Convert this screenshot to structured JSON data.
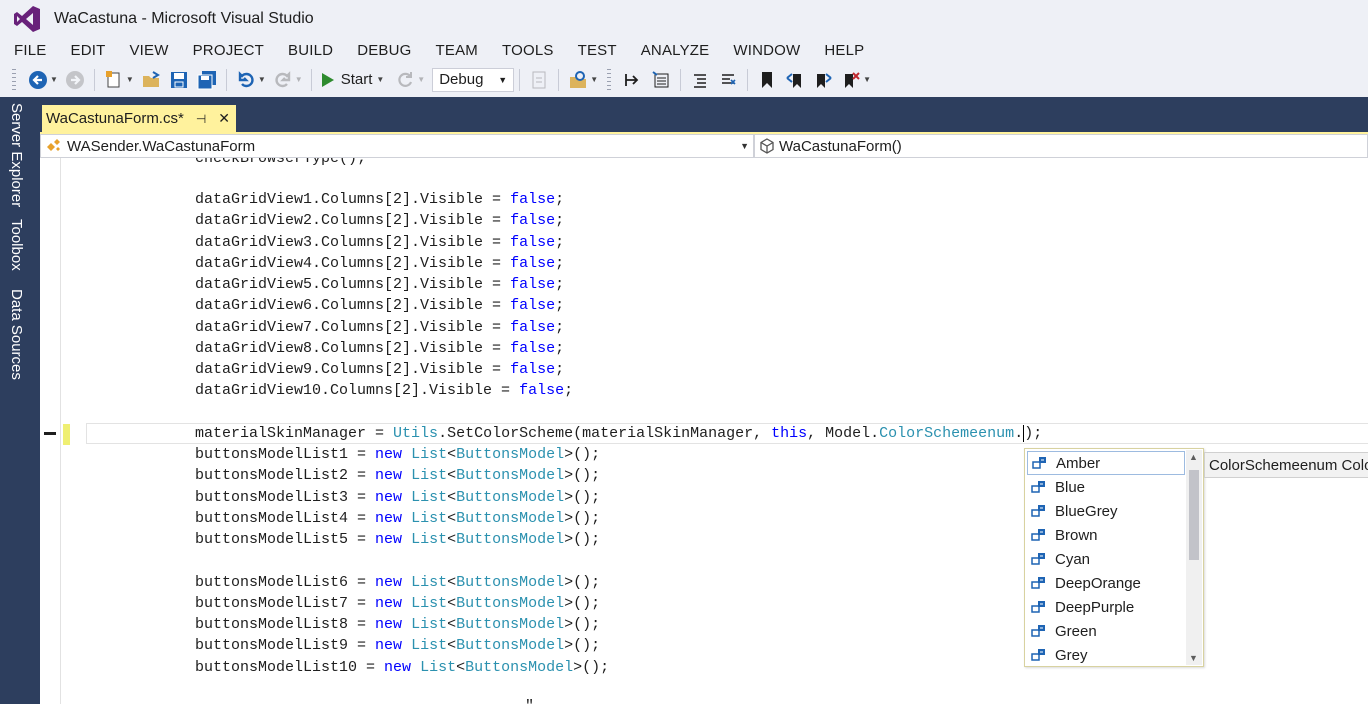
{
  "window": {
    "title": "WaCastuna - Microsoft Visual Studio"
  },
  "menu": [
    "FILE",
    "EDIT",
    "VIEW",
    "PROJECT",
    "BUILD",
    "DEBUG",
    "TEAM",
    "TOOLS",
    "TEST",
    "ANALYZE",
    "WINDOW",
    "HELP"
  ],
  "toolbar": {
    "start_label": "Start",
    "configuration": "Debug"
  },
  "side_tabs": [
    "Server Explorer",
    "Toolbox",
    "Data Sources"
  ],
  "document_tab": {
    "label": "WaCastunaForm.cs*",
    "pin": "⊣",
    "close": "✕"
  },
  "navigation": {
    "type_scope": "WASender.WaCastunaForm",
    "member_scope": "WaCastunaForm()"
  },
  "code": {
    "partial_top": "checkBrowserType();",
    "grid_lines": [
      "dataGridView1.Columns[2].Visible = ",
      "dataGridView2.Columns[2].Visible = ",
      "dataGridView3.Columns[2].Visible = ",
      "dataGridView4.Columns[2].Visible = ",
      "dataGridView5.Columns[2].Visible = ",
      "dataGridView6.Columns[2].Visible = ",
      "dataGridView7.Columns[2].Visible = ",
      "dataGridView8.Columns[2].Visible = ",
      "dataGridView9.Columns[2].Visible = ",
      "dataGridView10.Columns[2].Visible = "
    ],
    "kw_false": "false",
    "semicolon": ";",
    "current_line": {
      "p1": "materialSkinManager = ",
      "utils": "Utils",
      "p2": ".SetColorScheme(materialSkinManager, ",
      "kw_this": "this",
      "p3": ", Model.",
      "enum_type": "ColorSchemeenum",
      "p4": ".",
      "p5": ");"
    },
    "list_prefixes": [
      "buttonsModelList1 = ",
      "buttonsModelList2 = ",
      "buttonsModelList3 = ",
      "buttonsModelList4 = ",
      "buttonsModelList5 = ",
      "buttonsModelList6 = ",
      "buttonsModelList7 = ",
      "buttonsModelList8 = ",
      "buttonsModelList9 = ",
      "buttonsModelList10 = "
    ],
    "kw_new": "new",
    "ty_list": "List",
    "lt": "<",
    "ty_model": "ButtonsModel",
    "tail": ">();",
    "partial_bottom": "\""
  },
  "completion": {
    "items": [
      "Amber",
      "Blue",
      "BlueGrey",
      "Brown",
      "Cyan",
      "DeepOrange",
      "DeepPurple",
      "Green",
      "Grey"
    ],
    "selected_index": 0
  },
  "quickinfo": {
    "text": "ColorSchemeenum Color"
  },
  "colors": {
    "sidebar": "#2d3e5e",
    "tab_active": "#fff29d",
    "keyword": "#0000ff",
    "type": "#2b91af"
  }
}
